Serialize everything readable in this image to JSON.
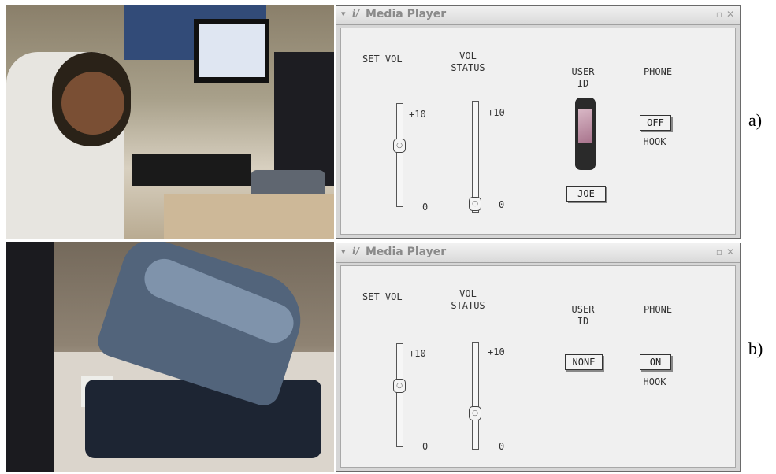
{
  "panels": [
    {
      "caption": "a)",
      "window": {
        "title": "Media Player",
        "labels": {
          "set_vol": "SET VOL",
          "vol_status_1": "VOL",
          "vol_status_2": "STATUS",
          "user_id_1": "USER",
          "user_id_2": "ID",
          "phone": "PHONE",
          "hook": "HOOK"
        },
        "set_vol_max": "+10",
        "set_vol_min": "0",
        "vol_status_max": "+10",
        "vol_status_min": "0",
        "user_id_value": "JOE",
        "phone_state": "OFF",
        "set_vol_level": 0.6,
        "vol_status_level": 0.0
      }
    },
    {
      "caption": "b)",
      "window": {
        "title": "Media Player",
        "labels": {
          "set_vol": "SET VOL",
          "vol_status_1": "VOL",
          "vol_status_2": "STATUS",
          "user_id_1": "USER",
          "user_id_2": "ID",
          "phone": "PHONE",
          "hook": "HOOK"
        },
        "set_vol_max": "+10",
        "set_vol_min": "0",
        "vol_status_max": "+10",
        "vol_status_min": "0",
        "user_id_value": "NONE",
        "phone_state": "ON",
        "set_vol_level": 0.6,
        "vol_status_level": 0.3
      }
    }
  ],
  "icons": {
    "title_logo": "media-player-logo-icon",
    "window_menu": "window-menu-arrow-icon",
    "minimize": "minimize-icon",
    "close": "close-icon",
    "slider_knob": "slider-knob-icon",
    "user_phone": "mobile-phone-icon"
  }
}
